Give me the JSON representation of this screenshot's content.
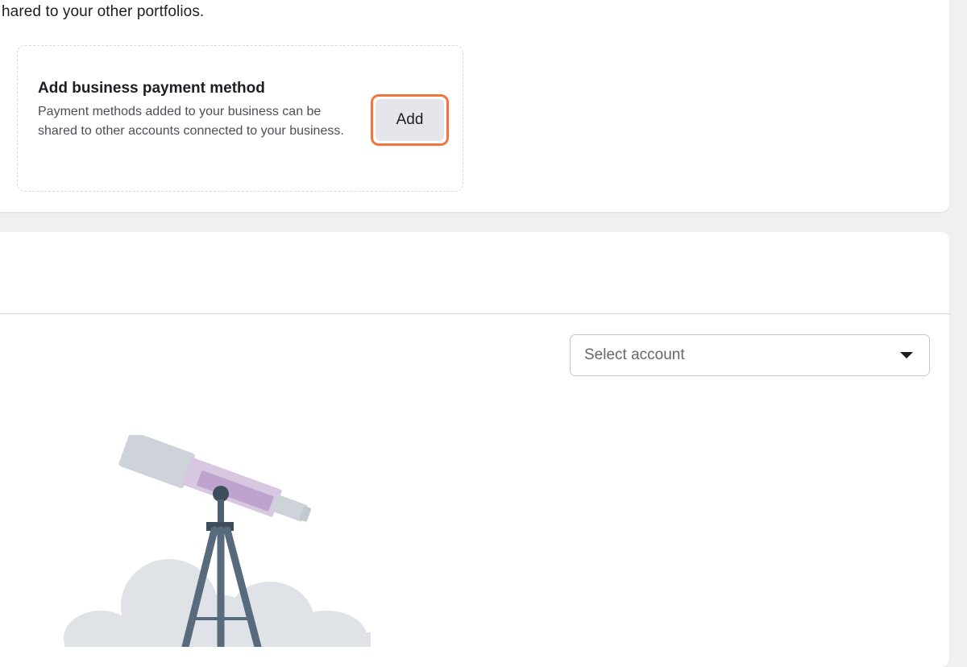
{
  "intro": {
    "text": "hared to your other portfolios."
  },
  "business_payment": {
    "title": "Add business payment method",
    "description": "Payment methods added to your business can be shared to other accounts connected to your business.",
    "add_label": "Add"
  },
  "account_select": {
    "placeholder": "Select account",
    "caret_icon": "caret-down-icon"
  },
  "illustration": {
    "icon": "telescope-illustration"
  },
  "colors": {
    "highlight_ring": "#f0763e",
    "button_bg": "#e4e6eb",
    "page_bg": "#f0f0f0"
  }
}
